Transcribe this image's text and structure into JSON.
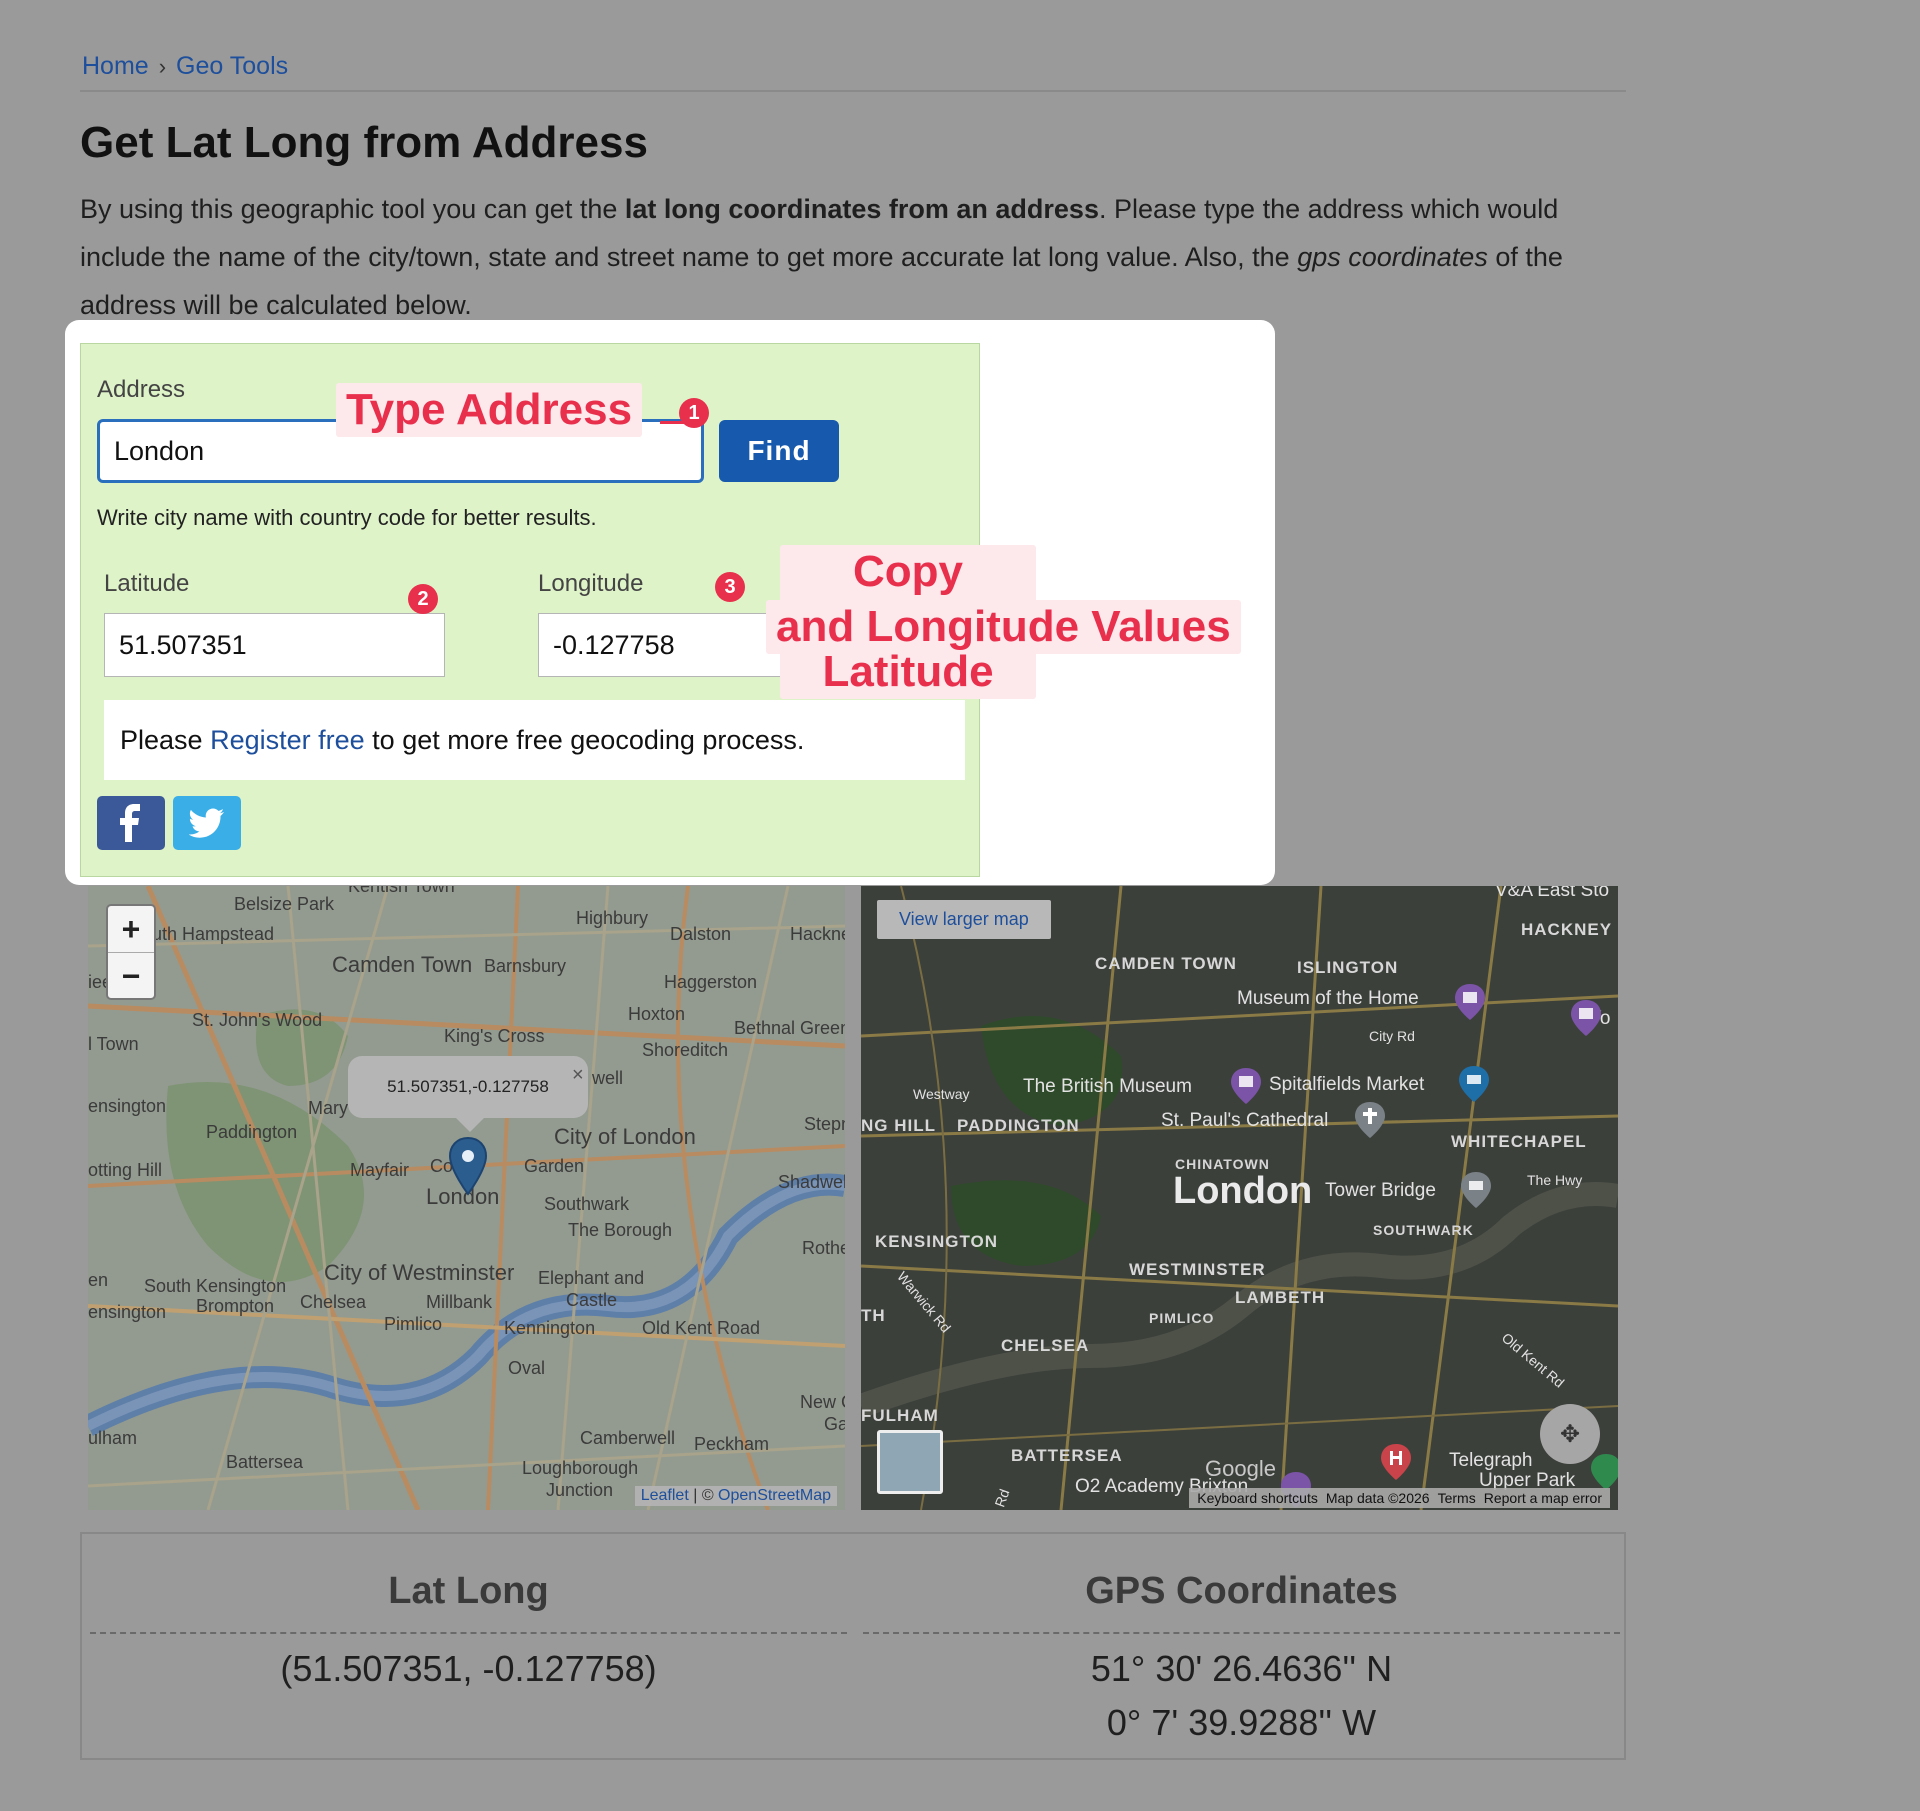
{
  "breadcrumb": {
    "home": "Home",
    "separator": "›",
    "current": "Geo Tools"
  },
  "page": {
    "title": "Get Lat Long from Address",
    "intro_1": "By using this geographic tool you can get the ",
    "intro_bold": "lat long coordinates from an address",
    "intro_2": ". Please type the address which would include the name of the city/town, state and street name to get more accurate lat long value. Also, the ",
    "intro_italic": "gps coordinates",
    "intro_3": " of the address will be calculated below."
  },
  "form": {
    "address_label": "Address",
    "address_value": "London",
    "find_label": "Find",
    "hint": "Write city name with country code for better results.",
    "latitude_label": "Latitude",
    "latitude_value": "51.507351",
    "longitude_label": "Longitude",
    "longitude_value": "-0.127758",
    "register_prefix": "Please ",
    "register_link": "Register free",
    "register_suffix": " to get more free geocoding process."
  },
  "annotations": {
    "type_address": "Type Address",
    "copy_line1": "Copy Paste Latitude",
    "copy_line2": "and Longitude Values",
    "badge1": "1",
    "badge2": "2",
    "badge3": "3"
  },
  "social": {
    "facebook_icon": "facebook-icon",
    "twitter_icon": "twitter-icon"
  },
  "colors": {
    "accent": "#1659ad",
    "annotation": "#e8304d",
    "panel": "#dff3c9"
  },
  "map1": {
    "zoom_in": "+",
    "zoom_out": "−",
    "popup_text": "51.507351,-0.127758",
    "popup_close": "×",
    "attr_leaflet": "Leaflet",
    "attr_sep": " | © ",
    "attr_osm": "OpenStreetMap",
    "labels": {
      "kentish_town": "Kentish Town",
      "belsize_park": "Belsize Park",
      "highbury": "Highbury",
      "south_hampstead": "uth Hampstead",
      "dalston": "Dalston",
      "hackney": "Hackne",
      "camden_town": "Camden Town",
      "barnsbury": "Barnsbury",
      "kilburn": "rk",
      "ee": "iee",
      "haggerston": "Haggerston",
      "st_johns_wood": "St. John's Wood",
      "hoxton": "Hoxton",
      "bethnal_green": "Bethnal Green",
      "kings_cross": "King's Cross",
      "town": "l Town",
      "shoreditch": "Shoreditch",
      "well": "well",
      "nsington": "ensington",
      "mary": "Mary",
      "paddington": "Paddington",
      "stepney": "Stepn",
      "city_of_london": "City of London",
      "notting_hill": "otting Hill",
      "mayfair": "Mayfair",
      "co": "Co",
      "garden": "Garden",
      "shadwell": "Shadwel",
      "london": "London",
      "southwark": "Southwark",
      "the_borough": "The Borough",
      "rotherhithe": "Rothe",
      "en": "en",
      "south_kensington": "South Kensington",
      "city_of_westminster": "City of Westminster",
      "elephant_and": "Elephant and",
      "castle": "Castle",
      "kensington": "ensington",
      "brompton": "Brompton",
      "chelsea": "Chelsea",
      "millbank": "Millbank",
      "pimlico": "Pimlico",
      "kennington": "Kennington",
      "old_kent_road": "Old Kent Road",
      "oval": "Oval",
      "new_cross": "New C",
      "ga": "Ga",
      "fulham": "ulham",
      "camberwell": "Camberwell",
      "peckham": "Peckham",
      "battersea": "Battersea",
      "loughborough": "Loughborough",
      "junction": "Junction"
    }
  },
  "map2": {
    "view_larger": "View larger map",
    "google": "Google",
    "keyboard": "Keyboard shortcuts",
    "map_data": "Map data ©2026",
    "terms": "Terms",
    "report": "Report a map error",
    "labels": {
      "va_east": "V&A East Sto",
      "hackney": "HACKNEY",
      "camden_town": "CAMDEN TOWN",
      "islington": "ISLINGTON",
      "museum_home": "Museum of the Home",
      "yo": "Yo",
      "city_rd": "City Rd",
      "westway": "Westway",
      "british_museum": "The British Museum",
      "spitalfields": "Spitalfields Market",
      "notting_hill": "NG HILL",
      "paddington": "PADDINGTON",
      "st_pauls": "St. Paul's Cathedral",
      "whitechapel": "WHITECHAPEL",
      "chinatown": "CHINATOWN",
      "london": "London",
      "tower_bridge": "Tower Bridge",
      "the_hwy": "The Hwy",
      "southwark": "SOUTHWARK",
      "kensington": "KENSINGTON",
      "westminster": "WESTMINSTER",
      "warwick_rd": "Warwick Rd",
      "lambeth": "LAMBETH",
      "th": "TH",
      "pimlico": "PIMLICO",
      "old_kent_rd": "Old Kent Rd",
      "chelsea": "CHELSEA",
      "fulham": "FULHAM",
      "battersea": "BATTERSEA",
      "telegraph": "Telegraph",
      "upper_park": "Upper Park",
      "o2_academy": "O2 Academy Brixton",
      "rd": "Rd"
    }
  },
  "results": {
    "latlong_title": "Lat Long",
    "latlong_value": "(51.507351, -0.127758)",
    "gps_title": "GPS Coordinates",
    "gps_lat": "51° 30' 26.4636'' N",
    "gps_lng": "0° 7' 39.9288'' W"
  }
}
